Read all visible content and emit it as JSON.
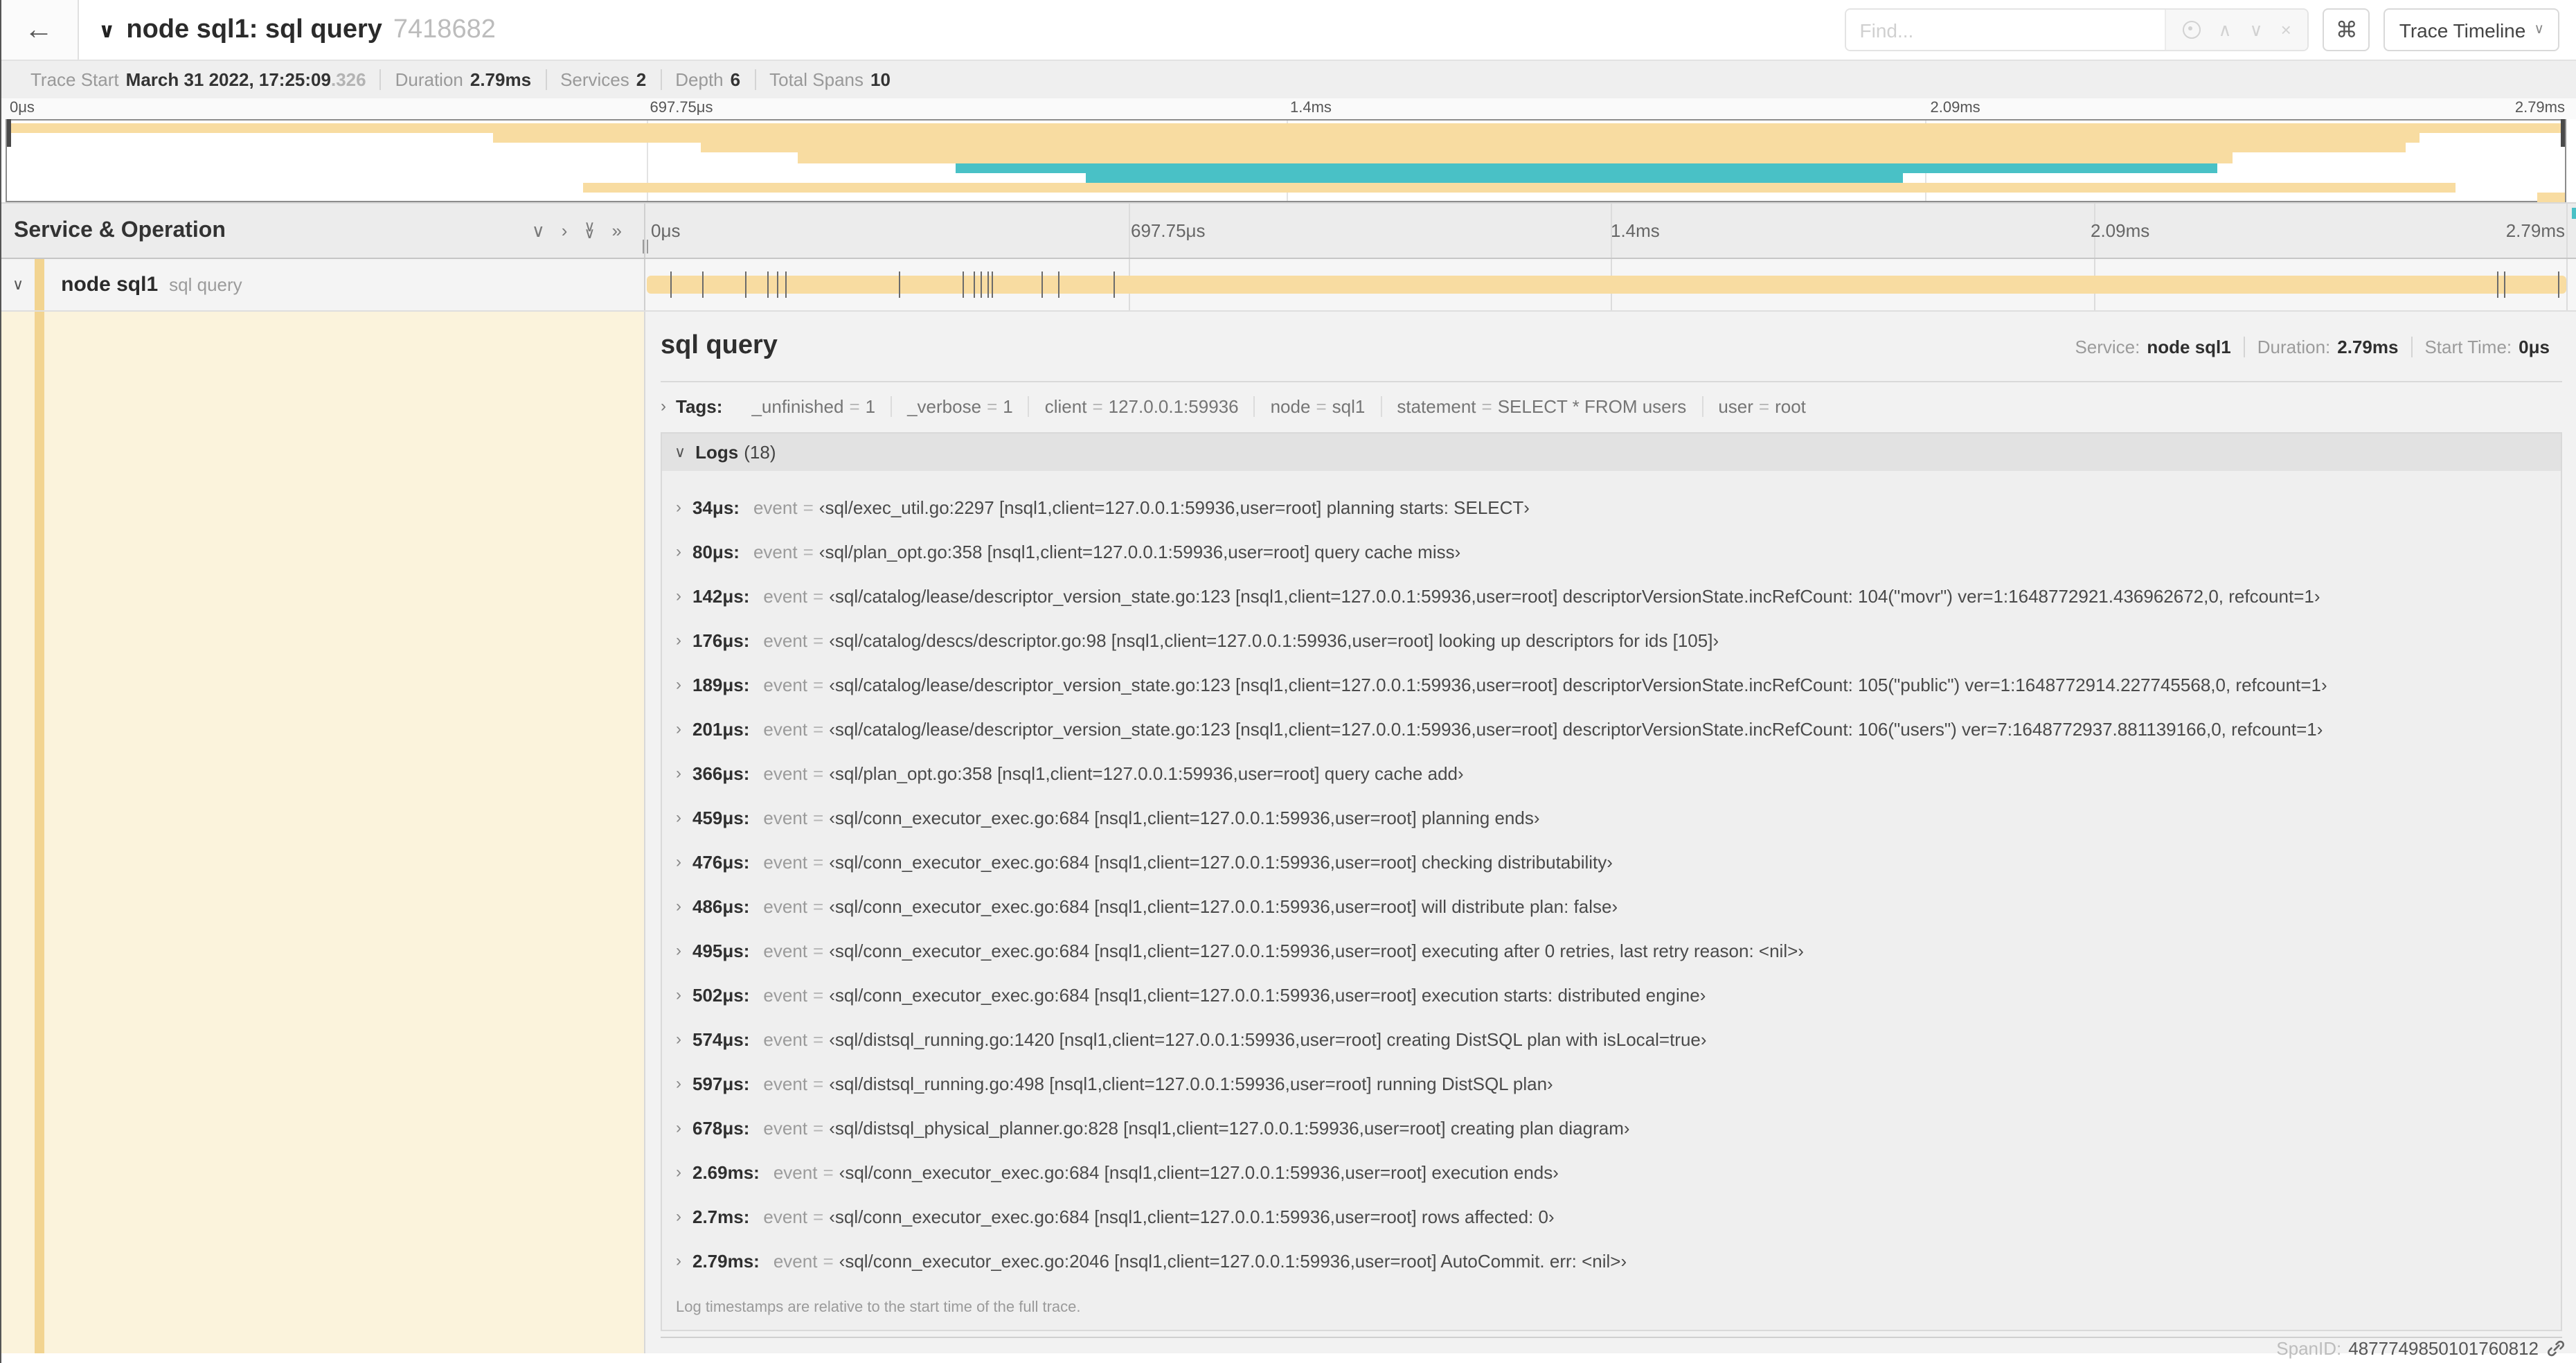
{
  "icons": {
    "back": "←",
    "collapse": "∨",
    "chevron_down": "∨",
    "chevron_right": "›",
    "double_chevron_right": "»",
    "up": "∧",
    "close": "×",
    "command": "⌘"
  },
  "colors": {
    "span_tan": "#f8dca1",
    "span_teal": "#49c1c6",
    "indent_tan": "#f2d491",
    "detail_cream": "#fbf3dc"
  },
  "header": {
    "title": "node sql1: sql query",
    "trace_id_short": "7418682",
    "find_placeholder": "Find...",
    "view_select_label": "Trace Timeline"
  },
  "trace_stats": {
    "start_label": "Trace Start",
    "start_value": "March 31 2022, 17:25:09",
    "start_ms": ".326",
    "duration_label": "Duration",
    "duration_value": "2.79ms",
    "services_label": "Services",
    "services_value": "2",
    "depth_label": "Depth",
    "depth_value": "6",
    "total_spans_label": "Total Spans",
    "total_spans_value": "10"
  },
  "timeline": {
    "ticks": [
      {
        "label": "0μs",
        "pos": 0
      },
      {
        "label": "697.75μs",
        "pos": 25
      },
      {
        "label": "1.4ms",
        "pos": 50
      },
      {
        "label": "2.09ms",
        "pos": 75
      },
      {
        "label": "2.79ms",
        "pos": 100
      }
    ],
    "header_left": "Service & Operation",
    "minimap_spans": [
      {
        "row": 0,
        "start": 0,
        "end": 100,
        "color": "#f8dca1"
      },
      {
        "row": 1,
        "start": 19,
        "end": 94.3,
        "color": "#f8dca1"
      },
      {
        "row": 2,
        "start": 27.1,
        "end": 93.8,
        "color": "#f8dca1"
      },
      {
        "row": 3,
        "start": 30.9,
        "end": 87,
        "color": "#f8dca1"
      },
      {
        "row": 4,
        "start": 37.1,
        "end": 86.4,
        "color": "#49c1c6"
      },
      {
        "row": 5,
        "start": 42.2,
        "end": 74.1,
        "color": "#49c1c6"
      },
      {
        "row": 6,
        "start": 22.5,
        "end": 95.7,
        "color": "#f8dca1"
      },
      {
        "row": 7,
        "start": 98.9,
        "end": 100,
        "color": "#f8dca1"
      }
    ]
  },
  "span_row": {
    "service": "node sql1",
    "operation": "sql query",
    "log_marker_positions": [
      1.22,
      2.87,
      5.09,
      6.31,
      6.77,
      7.2,
      13.12,
      16.45,
      17.06,
      17.42,
      17.74,
      18.0,
      20.57,
      21.4,
      24.3,
      96.42,
      96.77,
      99.6
    ]
  },
  "detail": {
    "title": "sql query",
    "meta": {
      "service_label": "Service:",
      "service_value": "node sql1",
      "duration_label": "Duration:",
      "duration_value": "2.79ms",
      "start_label": "Start Time:",
      "start_value": "0μs"
    },
    "tags_label": "Tags:",
    "tags": [
      {
        "key": "_unfinished",
        "value": "1"
      },
      {
        "key": "_verbose",
        "value": "1"
      },
      {
        "key": "client",
        "value": "127.0.0.1:59936"
      },
      {
        "key": "node",
        "value": "sql1"
      },
      {
        "key": "statement",
        "value": "SELECT * FROM users"
      },
      {
        "key": "user",
        "value": "root"
      }
    ],
    "logs_label": "Logs",
    "logs_count": "(18)",
    "log_key": "event",
    "logs": [
      {
        "time": "34μs:",
        "value": "‹sql/exec_util.go:2297 [nsql1,client=127.0.0.1:59936,user=root] planning starts: SELECT›"
      },
      {
        "time": "80μs:",
        "value": "‹sql/plan_opt.go:358 [nsql1,client=127.0.0.1:59936,user=root] query cache miss›"
      },
      {
        "time": "142μs:",
        "value": "‹sql/catalog/lease/descriptor_version_state.go:123 [nsql1,client=127.0.0.1:59936,user=root] descriptorVersionState.incRefCount: 104(\"movr\") ver=1:1648772921.436962672,0, refcount=1›"
      },
      {
        "time": "176μs:",
        "value": "‹sql/catalog/descs/descriptor.go:98 [nsql1,client=127.0.0.1:59936,user=root] looking up descriptors for ids [105]›"
      },
      {
        "time": "189μs:",
        "value": "‹sql/catalog/lease/descriptor_version_state.go:123 [nsql1,client=127.0.0.1:59936,user=root] descriptorVersionState.incRefCount: 105(\"public\") ver=1:1648772914.227745568,0, refcount=1›"
      },
      {
        "time": "201μs:",
        "value": "‹sql/catalog/lease/descriptor_version_state.go:123 [nsql1,client=127.0.0.1:59936,user=root] descriptorVersionState.incRefCount: 106(\"users\") ver=7:1648772937.881139166,0, refcount=1›"
      },
      {
        "time": "366μs:",
        "value": "‹sql/plan_opt.go:358 [nsql1,client=127.0.0.1:59936,user=root] query cache add›"
      },
      {
        "time": "459μs:",
        "value": "‹sql/conn_executor_exec.go:684 [nsql1,client=127.0.0.1:59936,user=root] planning ends›"
      },
      {
        "time": "476μs:",
        "value": "‹sql/conn_executor_exec.go:684 [nsql1,client=127.0.0.1:59936,user=root] checking distributability›"
      },
      {
        "time": "486μs:",
        "value": "‹sql/conn_executor_exec.go:684 [nsql1,client=127.0.0.1:59936,user=root] will distribute plan: false›"
      },
      {
        "time": "495μs:",
        "value": "‹sql/conn_executor_exec.go:684 [nsql1,client=127.0.0.1:59936,user=root] executing after 0 retries, last retry reason: <nil>›"
      },
      {
        "time": "502μs:",
        "value": "‹sql/conn_executor_exec.go:684 [nsql1,client=127.0.0.1:59936,user=root] execution starts: distributed engine›"
      },
      {
        "time": "574μs:",
        "value": "‹sql/distsql_running.go:1420 [nsql1,client=127.0.0.1:59936,user=root] creating DistSQL plan with isLocal=true›"
      },
      {
        "time": "597μs:",
        "value": "‹sql/distsql_running.go:498 [nsql1,client=127.0.0.1:59936,user=root] running DistSQL plan›"
      },
      {
        "time": "678μs:",
        "value": "‹sql/distsql_physical_planner.go:828 [nsql1,client=127.0.0.1:59936,user=root] creating plan diagram›"
      },
      {
        "time": "2.69ms:",
        "value": "‹sql/conn_executor_exec.go:684 [nsql1,client=127.0.0.1:59936,user=root] execution ends›"
      },
      {
        "time": "2.7ms:",
        "value": "‹sql/conn_executor_exec.go:684 [nsql1,client=127.0.0.1:59936,user=root] rows affected: 0›"
      },
      {
        "time": "2.79ms:",
        "value": "‹sql/conn_executor_exec.go:2046 [nsql1,client=127.0.0.1:59936,user=root] AutoCommit. err: <nil>›"
      }
    ],
    "logs_footnote": "Log timestamps are relative to the start time of the full trace.",
    "span_id_label": "SpanID:",
    "span_id": "4877749850101760812"
  }
}
